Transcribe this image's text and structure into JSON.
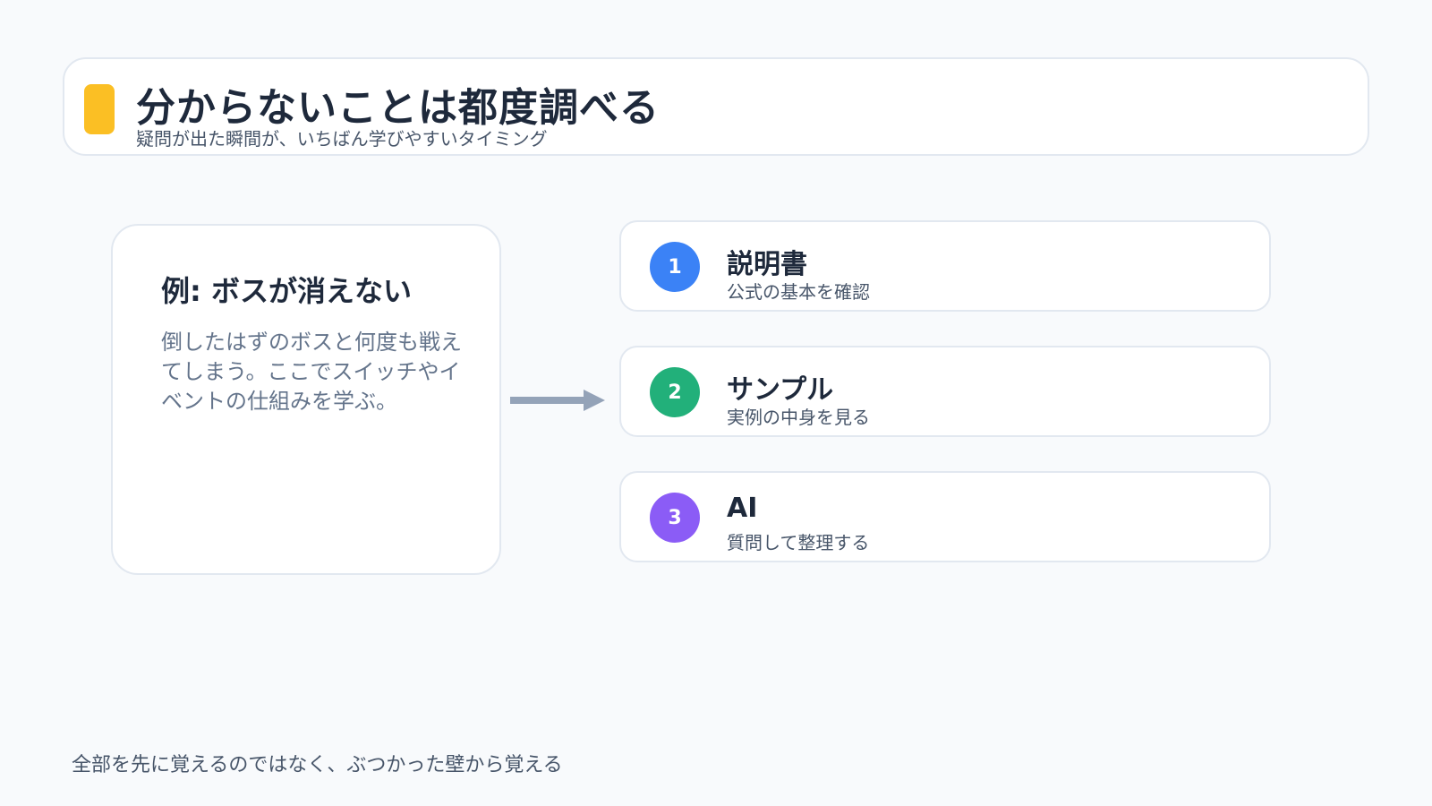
{
  "header": {
    "title": "分からないことは都度調べる",
    "subtitle": "疑問が出た瞬間が、いちばん学びやすいタイミング"
  },
  "example": {
    "title": "例: ボスが消えない",
    "body": "倒したはずのボスと何度も戦えてしまう。ここでスイッチやイベントの仕組みを学ぶ。"
  },
  "steps": [
    {
      "number": "1",
      "title": "説明書",
      "description": "公式の基本を確認",
      "color": "#3b82f6"
    },
    {
      "number": "2",
      "title": "サンプル",
      "description": "実例の中身を見る",
      "color": "#22b07a"
    },
    {
      "number": "3",
      "title": "AI",
      "description": "質問して整理する",
      "color": "#8b5cf6"
    }
  ],
  "footer": "全部を先に覚えるのではなく、ぶつかった壁から覚える",
  "colors": {
    "accent": "#fbbf24",
    "arrow": "#94a3b8"
  }
}
